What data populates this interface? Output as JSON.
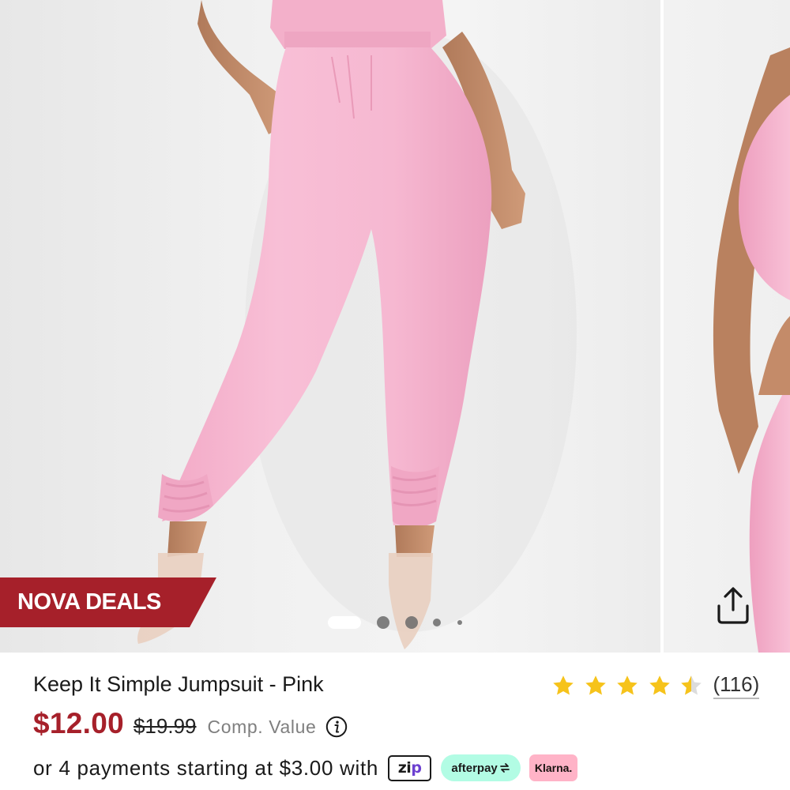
{
  "badge": {
    "label": "NOVA DEALS",
    "color": "#a6202a"
  },
  "carousel": {
    "slide_count": 6,
    "active_index": 0,
    "share_icon": "share-icon"
  },
  "product": {
    "title": "Keep It Simple Jumpsuit - Pink",
    "rating": {
      "value": 4.5,
      "max": 5,
      "review_count": "(116)",
      "star_color": "#f6c31b"
    },
    "price": {
      "sale": "$12.00",
      "original": "$19.99",
      "comp_label": "Comp. Value",
      "info_icon": "info-icon",
      "sale_color": "#a6202a"
    },
    "payments": {
      "text": "or 4 payments starting at $3.00 with",
      "zip_label_a": "zi",
      "zip_label_b": "p",
      "afterpay_label": "afterpay",
      "klarna_label": "Klarna."
    }
  }
}
